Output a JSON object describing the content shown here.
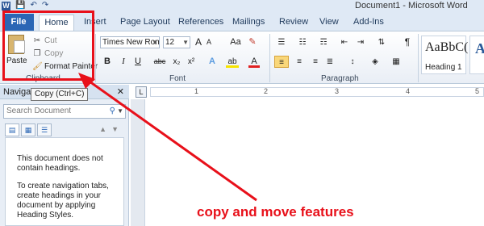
{
  "window": {
    "title": "Document1 - Microsoft Word"
  },
  "qat": {
    "app_icon": "W",
    "save_icon": "💾",
    "undo_icon": "↶",
    "redo_icon": "↷"
  },
  "tabs": [
    {
      "label": "File"
    },
    {
      "label": "Home"
    },
    {
      "label": "Insert"
    },
    {
      "label": "Page Layout"
    },
    {
      "label": "References"
    },
    {
      "label": "Mailings"
    },
    {
      "label": "Review"
    },
    {
      "label": "View"
    },
    {
      "label": "Add-Ins"
    }
  ],
  "clipboard": {
    "paste": "Paste",
    "cut": "Cut",
    "copy": "Copy",
    "format_painter": "Format Painter",
    "group": "Clipboard"
  },
  "font": {
    "name": "Times New Rom",
    "size": "12",
    "group": "Font",
    "buttons": {
      "grow": "A",
      "shrink": "A",
      "case": "Aa",
      "clear": "✎",
      "bold": "B",
      "italic": "I",
      "underline": "U",
      "strike": "abc",
      "sub": "x₂",
      "sup": "x²",
      "effects": "A",
      "highlight": "ab",
      "color": "A"
    }
  },
  "paragraph": {
    "group": "Paragraph"
  },
  "styles": [
    {
      "sample": "AaBbC(",
      "name": "Heading 1"
    },
    {
      "sample": "A",
      "name": ""
    }
  ],
  "tooltip": "Copy (Ctrl+C)",
  "nav": {
    "title": "Navigat",
    "search_placeholder": "Search Document",
    "text1": "This document does not contain headings.",
    "text2": "To create navigation tabs, create headings in your document by applying Heading Styles."
  },
  "ruler": {
    "numbers": [
      "1",
      "2",
      "3",
      "4",
      "5"
    ]
  },
  "annotation": {
    "caption": "copy and move features",
    "color": "#e8101a"
  }
}
